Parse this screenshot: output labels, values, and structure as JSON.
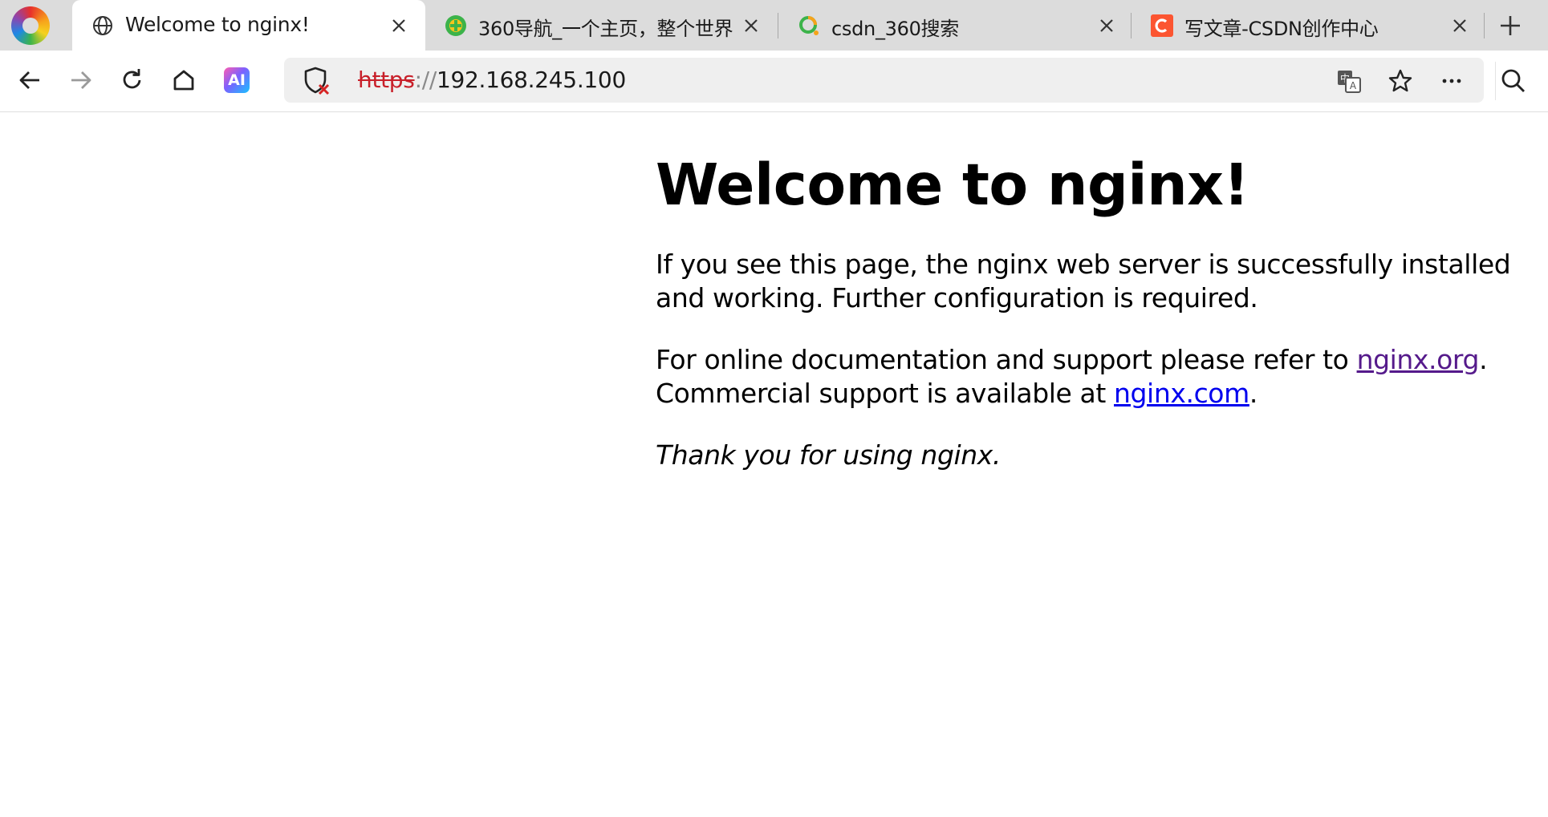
{
  "tabs": [
    {
      "title": "Welcome to nginx!",
      "active": true,
      "favicon": "globe-icon"
    },
    {
      "title": "360导航_一个主页，整个世界",
      "active": false,
      "favicon": "360-nav-icon"
    },
    {
      "title": "csdn_360搜索",
      "active": false,
      "favicon": "360-search-icon"
    },
    {
      "title": "写文章-CSDN创作中心",
      "active": false,
      "favicon": "csdn-icon"
    }
  ],
  "toolbar": {
    "ai_label": "AI",
    "url": {
      "scheme": "https",
      "separator": "://",
      "host": "192.168.245.100"
    }
  },
  "page": {
    "heading": "Welcome to nginx!",
    "paragraph1": "If you see this page, the nginx web server is successfully installed and working. Further configuration is required.",
    "paragraph2": {
      "text_before": "For online documentation and support please refer to ",
      "link1": "nginx.org",
      "text_middle": ".",
      "line2_before": "Commercial support is available at ",
      "link2": "nginx.com",
      "text_end": "."
    },
    "paragraph3": "Thank you for using nginx."
  },
  "colors": {
    "insecure_scheme": "#c8202a",
    "visited_link": "#551a8b",
    "unvisited_link": "#0000ee",
    "tabstrip_bg": "#dcdcdc",
    "addressbar_bg": "#efefef"
  }
}
